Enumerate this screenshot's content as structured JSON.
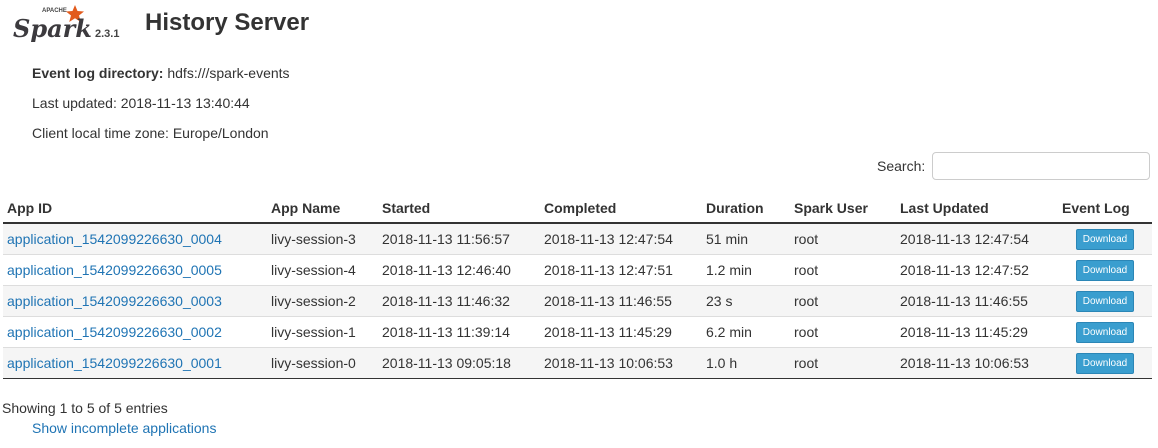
{
  "header": {
    "logo_apache": "APACHE",
    "logo_text": "Spark",
    "version": "2.3.1",
    "title": "History Server"
  },
  "info": {
    "event_log_label": "Event log directory:",
    "event_log_value": "hdfs:///spark-events",
    "last_updated": "Last updated: 2018-11-13 13:40:44",
    "timezone": "Client local time zone: Europe/London"
  },
  "search": {
    "label": "Search:",
    "value": ""
  },
  "table": {
    "headers": [
      "App ID",
      "App Name",
      "Started",
      "Completed",
      "Duration",
      "Spark User",
      "Last Updated",
      "Event Log"
    ],
    "rows": [
      {
        "app_id": "application_1542099226630_0004",
        "app_name": "livy-session-3",
        "started": "2018-11-13 11:56:57",
        "completed": "2018-11-13 12:47:54",
        "duration": "51 min",
        "user": "root",
        "last_updated": "2018-11-13 12:47:54",
        "event_log": "Download"
      },
      {
        "app_id": "application_1542099226630_0005",
        "app_name": "livy-session-4",
        "started": "2018-11-13 12:46:40",
        "completed": "2018-11-13 12:47:51",
        "duration": "1.2 min",
        "user": "root",
        "last_updated": "2018-11-13 12:47:52",
        "event_log": "Download"
      },
      {
        "app_id": "application_1542099226630_0003",
        "app_name": "livy-session-2",
        "started": "2018-11-13 11:46:32",
        "completed": "2018-11-13 11:46:55",
        "duration": "23 s",
        "user": "root",
        "last_updated": "2018-11-13 11:46:55",
        "event_log": "Download"
      },
      {
        "app_id": "application_1542099226630_0002",
        "app_name": "livy-session-1",
        "started": "2018-11-13 11:39:14",
        "completed": "2018-11-13 11:45:29",
        "duration": "6.2 min",
        "user": "root",
        "last_updated": "2018-11-13 11:45:29",
        "event_log": "Download"
      },
      {
        "app_id": "application_1542099226630_0001",
        "app_name": "livy-session-0",
        "started": "2018-11-13 09:05:18",
        "completed": "2018-11-13 10:06:53",
        "duration": "1.0 h",
        "user": "root",
        "last_updated": "2018-11-13 10:06:53",
        "event_log": "Download"
      }
    ]
  },
  "footer": {
    "showing": "Showing 1 to 5 of 5 entries",
    "show_incomplete": "Show incomplete applications"
  },
  "colors": {
    "link": "#1f74b4",
    "download_button": "#3a9ecf",
    "spark_star": "#e25a1c"
  }
}
